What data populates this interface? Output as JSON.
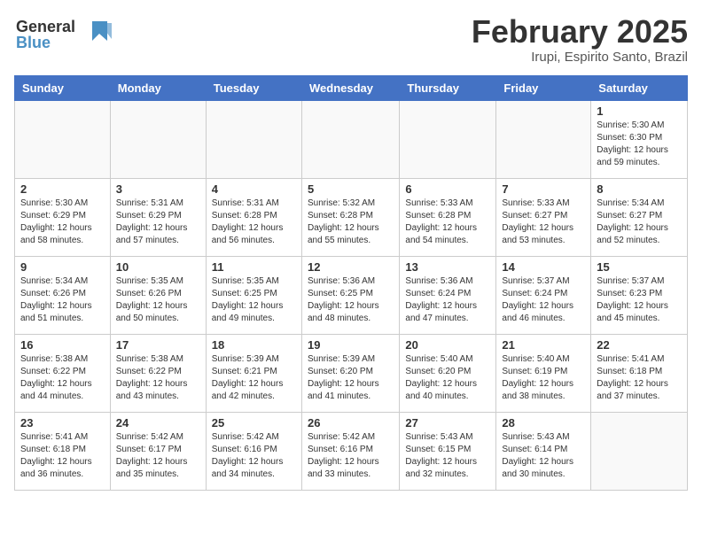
{
  "logo": {
    "line1": "General",
    "line2": "Blue"
  },
  "title": "February 2025",
  "subtitle": "Irupi, Espirito Santo, Brazil",
  "days_of_week": [
    "Sunday",
    "Monday",
    "Tuesday",
    "Wednesday",
    "Thursday",
    "Friday",
    "Saturday"
  ],
  "weeks": [
    [
      {
        "day": "",
        "info": ""
      },
      {
        "day": "",
        "info": ""
      },
      {
        "day": "",
        "info": ""
      },
      {
        "day": "",
        "info": ""
      },
      {
        "day": "",
        "info": ""
      },
      {
        "day": "",
        "info": ""
      },
      {
        "day": "1",
        "info": "Sunrise: 5:30 AM\nSunset: 6:30 PM\nDaylight: 12 hours\nand 59 minutes."
      }
    ],
    [
      {
        "day": "2",
        "info": "Sunrise: 5:30 AM\nSunset: 6:29 PM\nDaylight: 12 hours\nand 58 minutes."
      },
      {
        "day": "3",
        "info": "Sunrise: 5:31 AM\nSunset: 6:29 PM\nDaylight: 12 hours\nand 57 minutes."
      },
      {
        "day": "4",
        "info": "Sunrise: 5:31 AM\nSunset: 6:28 PM\nDaylight: 12 hours\nand 56 minutes."
      },
      {
        "day": "5",
        "info": "Sunrise: 5:32 AM\nSunset: 6:28 PM\nDaylight: 12 hours\nand 55 minutes."
      },
      {
        "day": "6",
        "info": "Sunrise: 5:33 AM\nSunset: 6:28 PM\nDaylight: 12 hours\nand 54 minutes."
      },
      {
        "day": "7",
        "info": "Sunrise: 5:33 AM\nSunset: 6:27 PM\nDaylight: 12 hours\nand 53 minutes."
      },
      {
        "day": "8",
        "info": "Sunrise: 5:34 AM\nSunset: 6:27 PM\nDaylight: 12 hours\nand 52 minutes."
      }
    ],
    [
      {
        "day": "9",
        "info": "Sunrise: 5:34 AM\nSunset: 6:26 PM\nDaylight: 12 hours\nand 51 minutes."
      },
      {
        "day": "10",
        "info": "Sunrise: 5:35 AM\nSunset: 6:26 PM\nDaylight: 12 hours\nand 50 minutes."
      },
      {
        "day": "11",
        "info": "Sunrise: 5:35 AM\nSunset: 6:25 PM\nDaylight: 12 hours\nand 49 minutes."
      },
      {
        "day": "12",
        "info": "Sunrise: 5:36 AM\nSunset: 6:25 PM\nDaylight: 12 hours\nand 48 minutes."
      },
      {
        "day": "13",
        "info": "Sunrise: 5:36 AM\nSunset: 6:24 PM\nDaylight: 12 hours\nand 47 minutes."
      },
      {
        "day": "14",
        "info": "Sunrise: 5:37 AM\nSunset: 6:24 PM\nDaylight: 12 hours\nand 46 minutes."
      },
      {
        "day": "15",
        "info": "Sunrise: 5:37 AM\nSunset: 6:23 PM\nDaylight: 12 hours\nand 45 minutes."
      }
    ],
    [
      {
        "day": "16",
        "info": "Sunrise: 5:38 AM\nSunset: 6:22 PM\nDaylight: 12 hours\nand 44 minutes."
      },
      {
        "day": "17",
        "info": "Sunrise: 5:38 AM\nSunset: 6:22 PM\nDaylight: 12 hours\nand 43 minutes."
      },
      {
        "day": "18",
        "info": "Sunrise: 5:39 AM\nSunset: 6:21 PM\nDaylight: 12 hours\nand 42 minutes."
      },
      {
        "day": "19",
        "info": "Sunrise: 5:39 AM\nSunset: 6:20 PM\nDaylight: 12 hours\nand 41 minutes."
      },
      {
        "day": "20",
        "info": "Sunrise: 5:40 AM\nSunset: 6:20 PM\nDaylight: 12 hours\nand 40 minutes."
      },
      {
        "day": "21",
        "info": "Sunrise: 5:40 AM\nSunset: 6:19 PM\nDaylight: 12 hours\nand 38 minutes."
      },
      {
        "day": "22",
        "info": "Sunrise: 5:41 AM\nSunset: 6:18 PM\nDaylight: 12 hours\nand 37 minutes."
      }
    ],
    [
      {
        "day": "23",
        "info": "Sunrise: 5:41 AM\nSunset: 6:18 PM\nDaylight: 12 hours\nand 36 minutes."
      },
      {
        "day": "24",
        "info": "Sunrise: 5:42 AM\nSunset: 6:17 PM\nDaylight: 12 hours\nand 35 minutes."
      },
      {
        "day": "25",
        "info": "Sunrise: 5:42 AM\nSunset: 6:16 PM\nDaylight: 12 hours\nand 34 minutes."
      },
      {
        "day": "26",
        "info": "Sunrise: 5:42 AM\nSunset: 6:16 PM\nDaylight: 12 hours\nand 33 minutes."
      },
      {
        "day": "27",
        "info": "Sunrise: 5:43 AM\nSunset: 6:15 PM\nDaylight: 12 hours\nand 32 minutes."
      },
      {
        "day": "28",
        "info": "Sunrise: 5:43 AM\nSunset: 6:14 PM\nDaylight: 12 hours\nand 30 minutes."
      },
      {
        "day": "",
        "info": ""
      }
    ]
  ]
}
